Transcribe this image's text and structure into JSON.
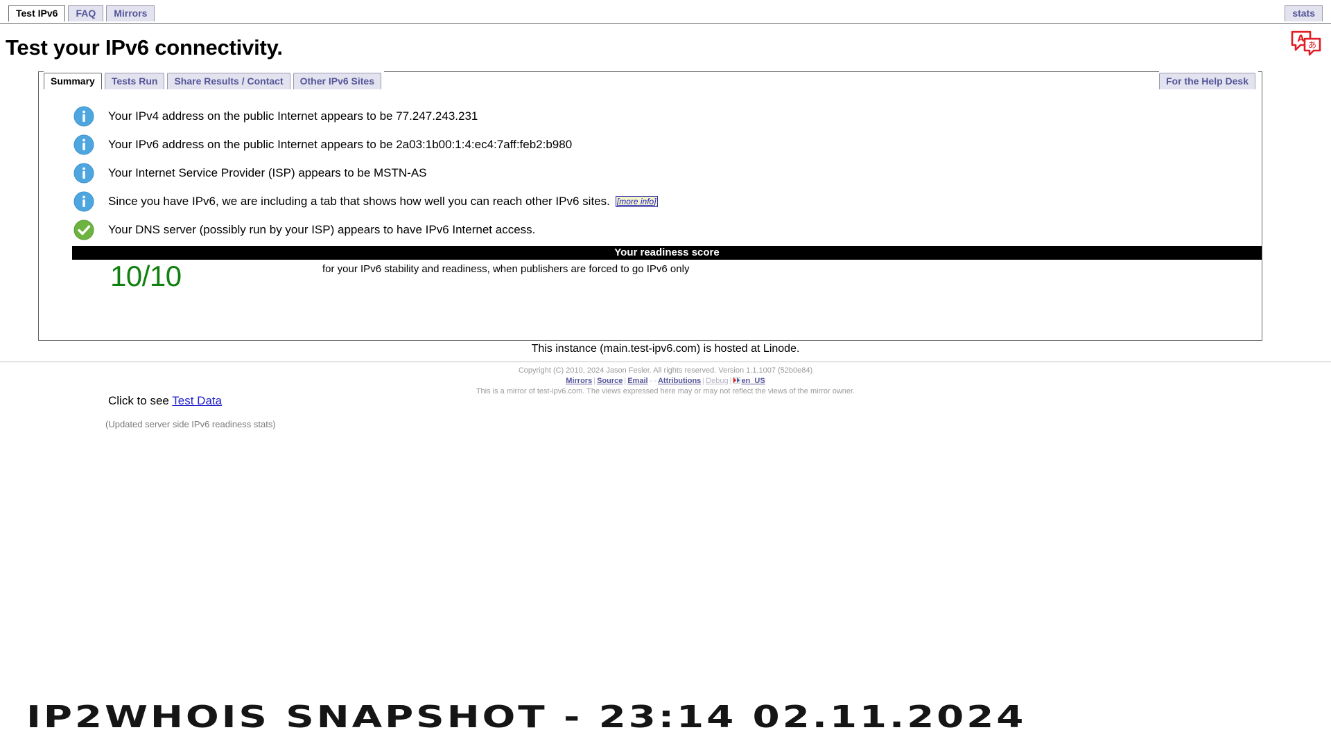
{
  "topbar": {
    "tabs": [
      {
        "label": "Test IPv6",
        "active": true
      },
      {
        "label": "FAQ",
        "active": false
      },
      {
        "label": "Mirrors",
        "active": false
      }
    ],
    "right_tabs": [
      {
        "label": "stats",
        "active": false
      }
    ]
  },
  "page_title": "Test your IPv6 connectivity.",
  "translate_icon": {
    "name": "translate-icon",
    "color": "#e01b24",
    "latin_glyph": "A",
    "other_glyph": "あ"
  },
  "panel": {
    "tabs": [
      {
        "label": "Summary",
        "active": true
      },
      {
        "label": "Tests Run",
        "active": false
      },
      {
        "label": "Share Results / Contact",
        "active": false
      },
      {
        "label": "Other IPv6 Sites",
        "active": false
      }
    ],
    "right_tabs": [
      {
        "label": "For the Help Desk",
        "active": false
      }
    ],
    "results": [
      {
        "icon": "info-icon",
        "icon_color": "#4ea6e0",
        "text": "Your IPv4 address on the public Internet appears to be 77.247.243.231",
        "link": null
      },
      {
        "icon": "info-icon",
        "icon_color": "#4ea6e0",
        "text": "Your IPv6 address on the public Internet appears to be 2a03:1b00:1:4:ec4:7aff:feb2:b980",
        "link": null
      },
      {
        "icon": "info-icon",
        "icon_color": "#4ea6e0",
        "text": "Your Internet Service Provider (ISP) appears to be MSTN-AS",
        "link": null
      },
      {
        "icon": "info-icon",
        "icon_color": "#4ea6e0",
        "text": "Since you have IPv6, we are including a tab that shows how well you can reach other IPv6 sites.",
        "link": "[more info]"
      },
      {
        "icon": "check-icon",
        "icon_color": "#6cb33f",
        "text": "Your DNS server (possibly run by your ISP) appears to have IPv6 Internet access.",
        "link": null
      }
    ],
    "score": {
      "bar_label": "Your readiness score",
      "bar_bg": "#000000",
      "bar_fg": "#ffffff",
      "value": "10/10",
      "value_color": "#108010",
      "caption": "for your IPv6 stability and readiness, when publishers are forced to go IPv6 only"
    },
    "click_prefix": "Click to see ",
    "click_link": "Test Data",
    "updated_note": "(Updated server side IPv6 readiness stats)"
  },
  "instance_line": "This instance (main.test-ipv6.com) is hosted at Linode.",
  "footer": {
    "copyright": "Copyright (C) 2010, 2024 Jason Fesler. All rights reserved. Version 1.1.1007 (52b0e84)",
    "links": [
      {
        "label": "Mirrors",
        "disabled": false
      },
      {
        "label": "Source",
        "disabled": false
      },
      {
        "label": "Email",
        "disabled": false
      },
      {
        "label": "Attributions",
        "disabled": false
      },
      {
        "label": "Debug",
        "disabled": true
      },
      {
        "label": "en_US",
        "disabled": false
      }
    ],
    "dash_text": "-   -",
    "mirror_note": "This is a mirror of test-ipv6.com. The views expressed here may or may not reflect the views of the mirror owner."
  },
  "watermark": "IP2WHOIS SNAPSHOT - 23:14 02.11.2024"
}
